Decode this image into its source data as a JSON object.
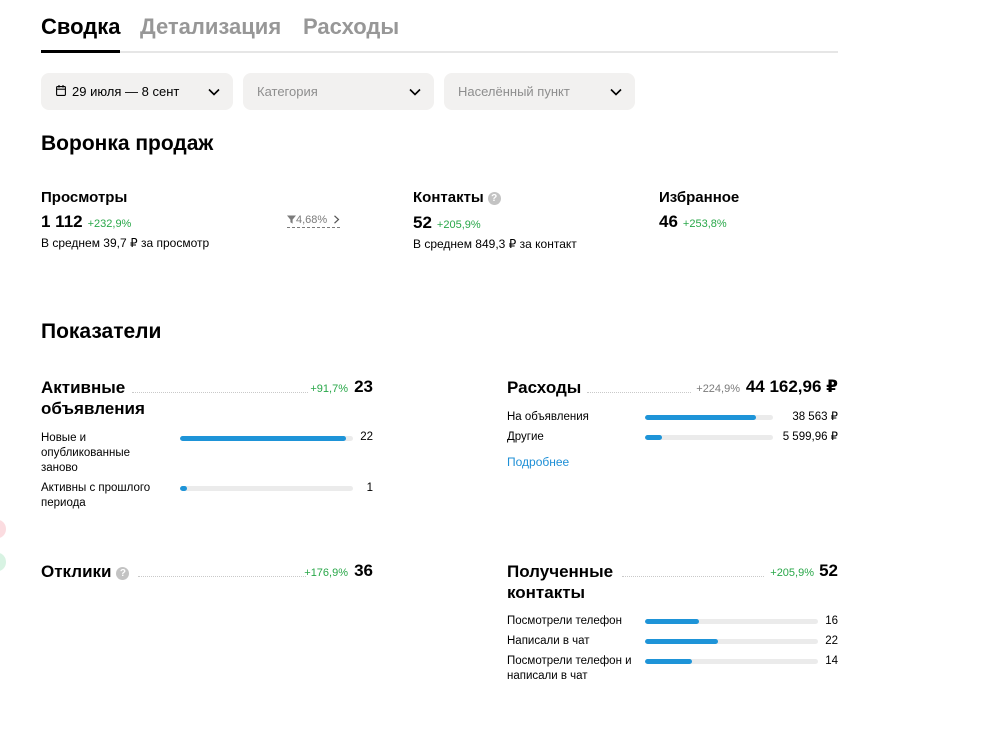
{
  "tabs": [
    {
      "label": "Сводка",
      "active": true
    },
    {
      "label": "Детализация",
      "active": false
    },
    {
      "label": "Расходы",
      "active": false
    }
  ],
  "filters": {
    "period": {
      "value": "29 июля — 8 сент",
      "icon": "calendar-icon"
    },
    "category": {
      "placeholder": "Категория"
    },
    "location": {
      "placeholder": "Населённый пункт"
    }
  },
  "funnel": {
    "title": "Воронка продаж",
    "views": {
      "label": "Просмотры",
      "value": "1 112",
      "change": "+232,9%",
      "sub": "В среднем 39,7 ₽ за просмотр"
    },
    "conversion": "4,68%",
    "contacts": {
      "label": "Контакты",
      "value": "52",
      "change": "+205,9%",
      "sub": "В среднем 849,3 ₽ за контакт"
    },
    "favorites": {
      "label": "Избранное",
      "value": "46",
      "change": "+253,8%"
    }
  },
  "metrics": {
    "title": "Показатели",
    "active_ads": {
      "title": "Активные объявления",
      "change": "+91,7%",
      "value": "23",
      "rows": [
        {
          "label": "Новые и опубликованные заново",
          "value": "22",
          "fraction": 0.96
        },
        {
          "label": "Активны с прошлого периода",
          "value": "1",
          "fraction": 0.04
        }
      ]
    },
    "expenses": {
      "title": "Расходы",
      "change": "+224,9%",
      "value": "44 162,96 ₽",
      "rows": [
        {
          "label": "На объявления",
          "value": "38 563 ₽",
          "fraction": 0.87
        },
        {
          "label": "Другие",
          "value": "5 599,96 ₽",
          "fraction": 0.13
        }
      ],
      "link": "Подробнее"
    },
    "responses": {
      "title": "Отклики",
      "change": "+176,9%",
      "value": "36"
    },
    "received_contacts": {
      "title": "Полученные контакты",
      "change": "+205,9%",
      "value": "52",
      "rows": [
        {
          "label": "Посмотрели телефон",
          "value": "16",
          "fraction": 0.31
        },
        {
          "label": "Написали в чат",
          "value": "22",
          "fraction": 0.42
        },
        {
          "label": "Посмотрели телефон и написали в чат",
          "value": "14",
          "fraction": 0.27
        }
      ]
    }
  },
  "colors": {
    "accent": "#1e94d8",
    "positive": "#29a749",
    "muted": "#979797",
    "track": "#ebebeb"
  }
}
